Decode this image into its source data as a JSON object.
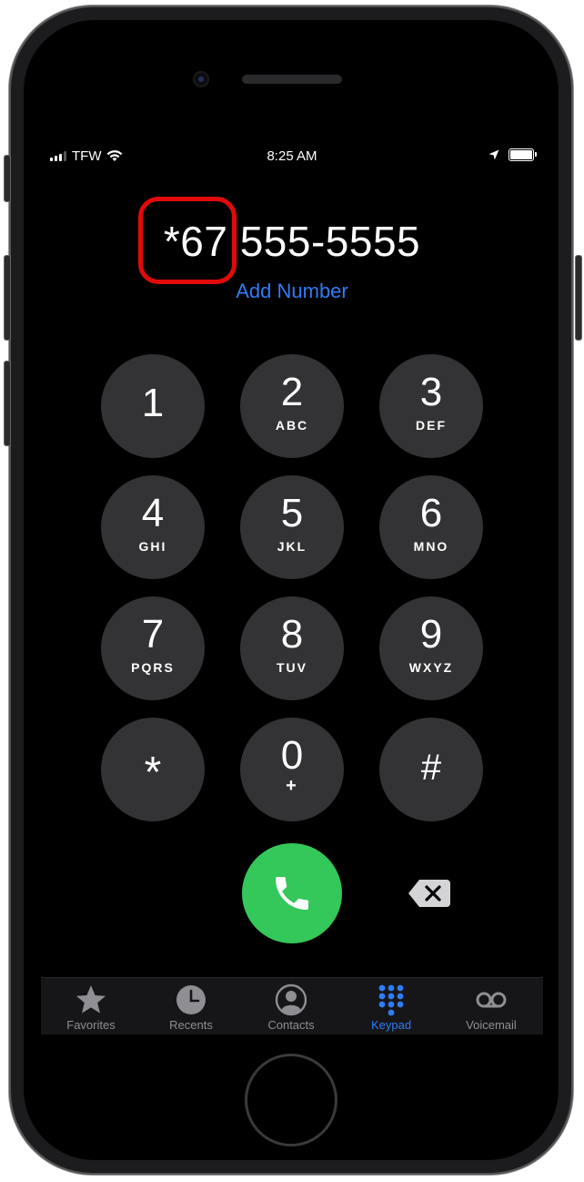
{
  "status_bar": {
    "carrier": "TFW",
    "time": "8:25 AM"
  },
  "dial": {
    "prefix": "*67",
    "number": " 555-5555",
    "add_number_label": "Add Number"
  },
  "keypad": {
    "keys": [
      {
        "digit": "1",
        "letters": ""
      },
      {
        "digit": "2",
        "letters": "ABC"
      },
      {
        "digit": "3",
        "letters": "DEF"
      },
      {
        "digit": "4",
        "letters": "GHI"
      },
      {
        "digit": "5",
        "letters": "JKL"
      },
      {
        "digit": "6",
        "letters": "MNO"
      },
      {
        "digit": "7",
        "letters": "PQRS"
      },
      {
        "digit": "8",
        "letters": "TUV"
      },
      {
        "digit": "9",
        "letters": "WXYZ"
      },
      {
        "digit": "*",
        "letters": ""
      },
      {
        "digit": "0",
        "letters": "+"
      },
      {
        "digit": "#",
        "letters": ""
      }
    ]
  },
  "tabs": [
    {
      "label": "Favorites",
      "icon": "star-icon"
    },
    {
      "label": "Recents",
      "icon": "clock-icon"
    },
    {
      "label": "Contacts",
      "icon": "person-circle-icon"
    },
    {
      "label": "Keypad",
      "icon": "keypad-icon",
      "active": true
    },
    {
      "label": "Voicemail",
      "icon": "voicemail-icon"
    }
  ],
  "colors": {
    "accent": "#2f7cf6",
    "call_green": "#34c759",
    "highlight_red": "#e10a0a",
    "key_bg": "#333335"
  }
}
